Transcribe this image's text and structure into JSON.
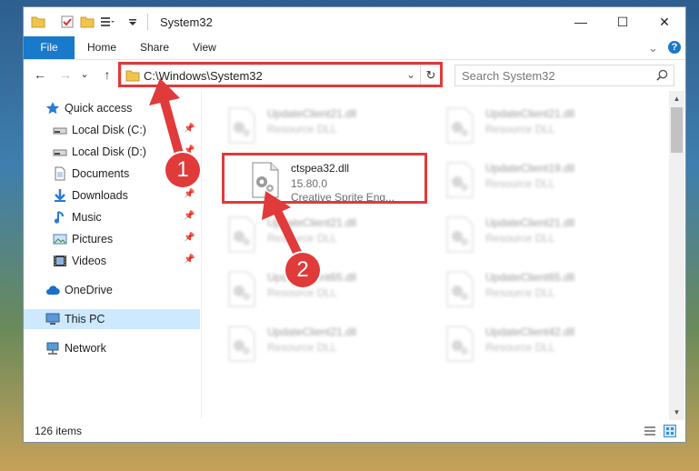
{
  "window": {
    "title": "System32",
    "minimize": "—",
    "maximize": "☐",
    "close": "✕"
  },
  "ribbon": {
    "tabs": [
      "File",
      "Home",
      "Share",
      "View"
    ],
    "collapse": "⌄",
    "help": "?"
  },
  "navbar": {
    "back": "←",
    "forward": "→",
    "recent": "⌄",
    "up": "↑",
    "address": "C:\\Windows\\System32",
    "address_dropdown": "⌄",
    "refresh": "↻",
    "search_placeholder": "Search System32"
  },
  "sidebar": {
    "items": [
      {
        "label": "Quick access",
        "icon": "star-icon",
        "pinned": false
      },
      {
        "label": "Local Disk (C:)",
        "icon": "drive-icon",
        "pinned": true
      },
      {
        "label": "Local Disk (D:)",
        "icon": "drive-icon",
        "pinned": true
      },
      {
        "label": "Documents",
        "icon": "documents-icon",
        "pinned": true
      },
      {
        "label": "Downloads",
        "icon": "downloads-icon",
        "pinned": true
      },
      {
        "label": "Music",
        "icon": "music-icon",
        "pinned": true
      },
      {
        "label": "Pictures",
        "icon": "pictures-icon",
        "pinned": true
      },
      {
        "label": "Videos",
        "icon": "videos-icon",
        "pinned": true
      },
      {
        "label": "OneDrive",
        "icon": "cloud-icon",
        "pinned": false
      },
      {
        "label": "This PC",
        "icon": "pc-icon",
        "pinned": false,
        "selected": true
      },
      {
        "label": "Network",
        "icon": "network-icon",
        "pinned": false
      }
    ]
  },
  "files": {
    "highlighted": {
      "name": "ctspea32.dll",
      "version": "15.80.0",
      "description": "Creative Sprite Eng..."
    },
    "blurred": [
      {
        "name": "UpdateClient21.dll",
        "description": "Resource DLL"
      },
      {
        "name": "UpdateClient21.dll",
        "description": "Resource DLL"
      },
      {
        "name": "UpdateClient19.dll",
        "description": "Resource DLL"
      },
      {
        "name": "UpdateClient21.dll",
        "description": "Resource DLL"
      },
      {
        "name": "UpdateClient21.dll",
        "description": "Resource DLL"
      },
      {
        "name": "UpdateClient65.dll",
        "description": "Resource DLL"
      },
      {
        "name": "UpdateClient65.dll",
        "description": "Resource DLL"
      },
      {
        "name": "UpdateClient21.dll",
        "description": "Resource DLL"
      },
      {
        "name": "UpdateClient42.dll",
        "description": "Resource DLL"
      }
    ]
  },
  "status": {
    "item_count": "126 items"
  },
  "annotations": {
    "step1": "1",
    "step2": "2",
    "color": "#e03a3a"
  }
}
